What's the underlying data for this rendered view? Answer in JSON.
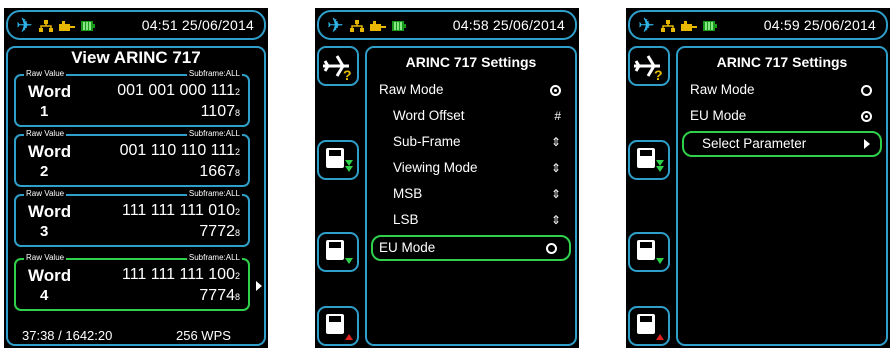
{
  "screen1": {
    "time": "04:51 25/06/2014",
    "title": "View ARINC 717",
    "words": [
      {
        "legend_left": "Raw Value",
        "legend_right": "Subframe:ALL",
        "label": "Word",
        "number": "1",
        "binary": "001 001 000 111",
        "binary_base": "2",
        "octal": "1107",
        "octal_base": "8"
      },
      {
        "legend_left": "Raw Value",
        "legend_right": "Subframe:ALL",
        "label": "Word",
        "number": "2",
        "binary": "001 110 110 111",
        "binary_base": "2",
        "octal": "1667",
        "octal_base": "8"
      },
      {
        "legend_left": "Raw Value",
        "legend_right": "Subframe:ALL",
        "label": "Word",
        "number": "3",
        "binary": "111 111 111 010",
        "binary_base": "2",
        "octal": "7772",
        "octal_base": "8"
      },
      {
        "legend_left": "Raw Value",
        "legend_right": "Subframe:ALL",
        "label": "Word",
        "number": "4",
        "binary": "111 111 111 100",
        "binary_base": "2",
        "octal": "7774",
        "octal_base": "8"
      }
    ],
    "footer_time": "37:38 / 1642:20",
    "footer_rate": "256 WPS"
  },
  "screen2": {
    "time": "04:58 25/06/2014",
    "title": "ARINC 717 Settings",
    "items": [
      {
        "label": "Raw Mode",
        "symbol": "radio-on"
      },
      {
        "label": "Word Offset",
        "symbol_text": "#"
      },
      {
        "label": "Sub-Frame",
        "symbol_text": "⇕"
      },
      {
        "label": "Viewing Mode",
        "symbol_text": "⇕"
      },
      {
        "label": "MSB",
        "symbol_text": "⇕"
      },
      {
        "label": "LSB",
        "symbol_text": "⇕"
      },
      {
        "label": "EU Mode",
        "symbol": "radio-off",
        "selected": true
      }
    ]
  },
  "screen3": {
    "time": "04:59 25/06/2014",
    "title": "ARINC 717 Settings",
    "items": [
      {
        "label": "Raw Mode",
        "symbol": "radio-off"
      },
      {
        "label": "EU Mode",
        "symbol": "radio-on"
      },
      {
        "label": "Select Parameter",
        "symbol": "arrow-right",
        "selected": true
      }
    ]
  },
  "colors": {
    "frame": "#2f9fc9",
    "select": "#2fd14a",
    "plane": "#2fb3e6",
    "network": "#e8b800",
    "battery": "#1a9a1a",
    "warning": "#e0201e"
  },
  "icons": [
    "airplane-icon",
    "network-icon",
    "power-icon",
    "battery-icon",
    "airplane-help-icon",
    "save-icon",
    "save-down-icon",
    "save-up-icon"
  ]
}
